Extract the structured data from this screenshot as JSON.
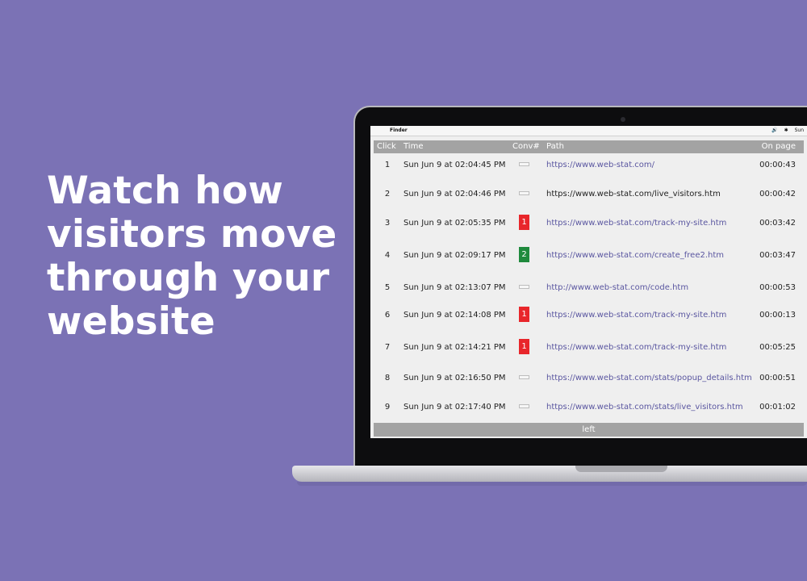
{
  "headline": [
    "Watch how",
    "visitors move",
    "through your",
    "website"
  ],
  "menubar": {
    "apple": "",
    "app": "Finder",
    "status_volume": "🔊",
    "status_bt": "✱",
    "status_day": "Sun"
  },
  "table": {
    "headers": {
      "click": "Click",
      "time": "Time",
      "conv": "Conv#",
      "path": "Path",
      "on_page": "On page"
    },
    "rows": [
      {
        "click": "1",
        "time": "Sun Jun 9 at 02:04:45 PM",
        "conv": "",
        "path": "https://www.web-stat.com/",
        "on_page": "00:00:43"
      },
      {
        "click": "2",
        "time": "Sun Jun 9 at 02:04:46 PM",
        "conv": "",
        "path": "https://www.web-stat.com/live_visitors.htm",
        "on_page": "00:00:42"
      },
      {
        "click": "3",
        "time": "Sun Jun 9 at 02:05:35 PM",
        "conv": "1",
        "path": "https://www.web-stat.com/track-my-site.htm",
        "on_page": "00:03:42"
      },
      {
        "click": "4",
        "time": "Sun Jun 9 at 02:09:17 PM",
        "conv": "2",
        "path": "https://www.web-stat.com/create_free2.htm",
        "on_page": "00:03:47"
      },
      {
        "click": "5",
        "time": "Sun Jun 9 at 02:13:07 PM",
        "conv": "",
        "path": "http://www.web-stat.com/code.htm",
        "on_page": "00:00:53"
      },
      {
        "click": "6",
        "time": "Sun Jun 9 at 02:14:08 PM",
        "conv": "1",
        "path": "https://www.web-stat.com/track-my-site.htm",
        "on_page": "00:00:13"
      },
      {
        "click": "7",
        "time": "Sun Jun 9 at 02:14:21 PM",
        "conv": "1",
        "path": "https://www.web-stat.com/track-my-site.htm",
        "on_page": "00:05:25"
      },
      {
        "click": "8",
        "time": "Sun Jun 9 at 02:16:50 PM",
        "conv": "",
        "path": "https://www.web-stat.com/stats/popup_details.htm",
        "on_page": "00:00:51"
      },
      {
        "click": "9",
        "time": "Sun Jun 9 at 02:17:40 PM",
        "conv": "",
        "path": "https://www.web-stat.com/stats/live_visitors.htm",
        "on_page": "00:01:02"
      }
    ],
    "footer": "left"
  },
  "colors": {
    "background": "#7b72b5",
    "conv_1": "#e8262b",
    "conv_2": "#1f8a3d",
    "link": "#5a56a0"
  }
}
